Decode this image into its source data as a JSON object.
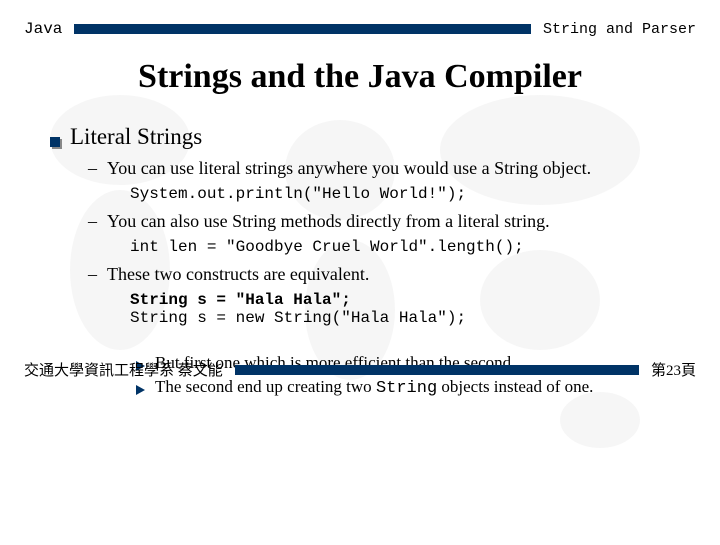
{
  "header": {
    "left": "Java",
    "right": "String and Parser"
  },
  "title": "Strings and the Java Compiler",
  "section": {
    "heading": "Literal Strings",
    "points": [
      {
        "text": "You can use literal strings anywhere you would use a String object.",
        "code": "System.out.println(\"Hello World!\");"
      },
      {
        "text": "You can also use String methods directly from a literal string.",
        "code": "int len = \"Goodbye Cruel World\".length();"
      },
      {
        "text": "These two constructs are equivalent.",
        "code_bold": "String s = \"Hala Hala\";",
        "code2": "String s = new String(\"Hala Hala\");",
        "sub": [
          "But first one which is more efficient than the second.",
          "The second end up creating two String objects instead of one."
        ]
      }
    ]
  },
  "footer": {
    "left": "交通大學資訊工程學系 蔡文能",
    "right": "第23頁"
  }
}
